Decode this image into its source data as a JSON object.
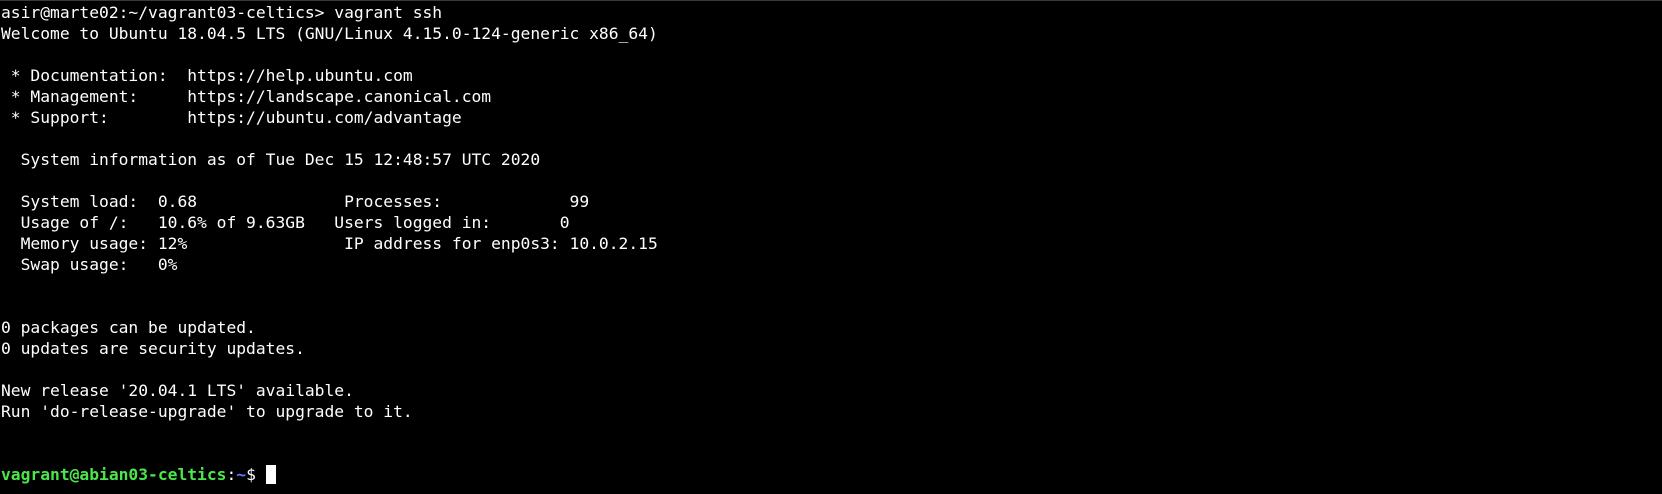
{
  "terminal": {
    "lines": [
      "asir@marte02:~/vagrant03-celtics> vagrant ssh",
      "Welcome to Ubuntu 18.04.5 LTS (GNU/Linux 4.15.0-124-generic x86_64)",
      "",
      " * Documentation:  https://help.ubuntu.com",
      " * Management:     https://landscape.canonical.com",
      " * Support:        https://ubuntu.com/advantage",
      "",
      "  System information as of Tue Dec 15 12:48:57 UTC 2020",
      "",
      "  System load:  0.68               Processes:             99",
      "  Usage of /:   10.6% of 9.63GB   Users logged in:       0",
      "  Memory usage: 12%                IP address for enp0s3: 10.0.2.15",
      "  Swap usage:   0%",
      "",
      "",
      "0 packages can be updated.",
      "0 updates are security updates.",
      "",
      "New release '20.04.1 LTS' available.",
      "Run 'do-release-upgrade' to upgrade to it.",
      "",
      ""
    ],
    "prompt": {
      "user_host": "vagrant@abian03-celtics",
      "separator": ":",
      "path": "~",
      "symbol": "$ "
    },
    "colors": {
      "background": "#000000",
      "text": "#ffffff",
      "prompt_user": "#4be64b",
      "prompt_path": "#5c7cff",
      "cursor": "#ffffff"
    }
  }
}
